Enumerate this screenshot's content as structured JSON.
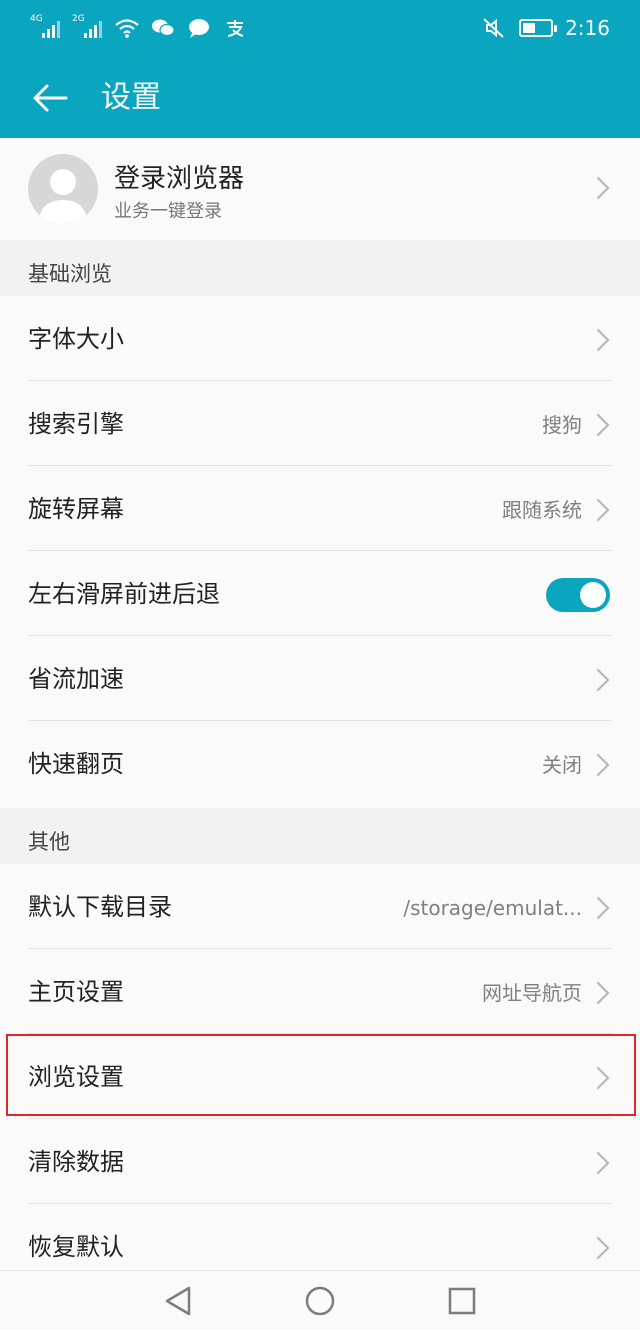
{
  "status_bar": {
    "sim1_tag": "4G",
    "sim2_tag": "2G",
    "time": "2:16",
    "icons": [
      "signal-icon",
      "wifi-icon",
      "wechat-icon",
      "message-icon",
      "alipay-icon",
      "mute-icon",
      "battery-icon"
    ]
  },
  "header": {
    "title": "设置"
  },
  "account": {
    "title": "登录浏览器",
    "subtitle": "业务一键登录"
  },
  "sections": [
    {
      "title": "基础浏览",
      "items": [
        {
          "label": "字体大小",
          "value": ""
        },
        {
          "label": "搜索引擎",
          "value": "搜狗"
        },
        {
          "label": "旋转屏幕",
          "value": "跟随系统"
        },
        {
          "label": "左右滑屏前进后退",
          "toggle": true
        },
        {
          "label": "省流加速",
          "value": ""
        },
        {
          "label": "快速翻页",
          "value": "关闭"
        }
      ]
    },
    {
      "title": "其他",
      "items": [
        {
          "label": "默认下载目录",
          "value": "/storage/emulat..."
        },
        {
          "label": "主页设置",
          "value": "网址导航页"
        },
        {
          "label": "浏览设置",
          "value": "",
          "highlighted": true
        },
        {
          "label": "清除数据",
          "value": ""
        },
        {
          "label": "恢复默认",
          "value": ""
        }
      ]
    }
  ],
  "colors": {
    "accent": "#0aa5bf",
    "highlight_border": "#e0262b",
    "background": "#f2f2f2"
  }
}
